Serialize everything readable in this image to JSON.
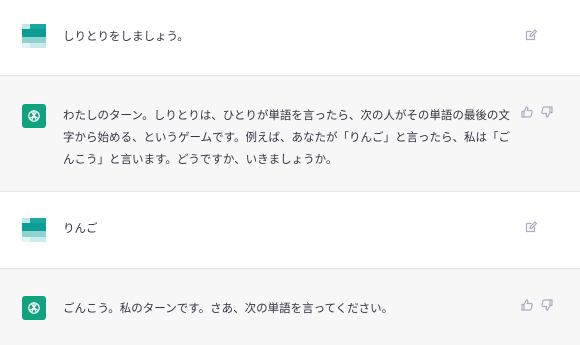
{
  "messages": [
    {
      "role": "user",
      "text": "しりとりをしましょう。",
      "actions": [
        "edit-icon"
      ]
    },
    {
      "role": "assistant",
      "text": "わたしのターン。しりとりは、ひとりが単語を言ったら、次の人がその単語の最後の文字から始める、というゲームです。例えば、あなたが「りんご」と言ったら、私は「ごんこう」と言います。どうですか、いきましょうか。",
      "actions": [
        "thumbs-up-icon",
        "thumbs-down-icon"
      ]
    },
    {
      "role": "user",
      "text": "りんご",
      "actions": [
        "edit-icon"
      ]
    },
    {
      "role": "assistant",
      "text": "ごんこう。私のターンです。さあ、次の単語を言ってください。",
      "actions": [
        "thumbs-up-icon",
        "thumbs-down-icon"
      ]
    }
  ],
  "colors": {
    "assistant_avatar_bg": "#10a37f",
    "assistant_row_bg": "#f7f7f8",
    "user_avatar_teal": "#1aa7a2",
    "user_avatar_light": "#9fd9d6",
    "icon_gray": "#acacbe"
  }
}
